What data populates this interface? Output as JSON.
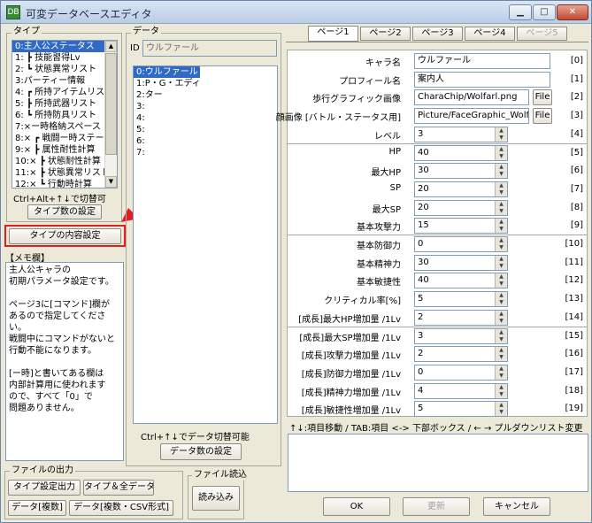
{
  "window": {
    "title": "可変データベースエディタ",
    "icon_label": "DB"
  },
  "type_panel": {
    "label": "タイプ",
    "items": [
      "0:主人公ステータス",
      "1: ┣ 技能習得Lv",
      "2: ┗ 状態異常リスト",
      "3:パーティー情報",
      "4: ┏ 所持アイテムリスト",
      "5: ┣ 所持武器リスト",
      "6: ┗ 所持防具リスト",
      "7:×ー時格納スペース",
      "8:× ┏ 戦闘ー時ステータス",
      "9:× ┣ 属性耐性計算",
      "10:× ┣ 状態耐性計算",
      "11:× ┣ 状態異常リスト",
      "12:× ┗ 行動時計算"
    ],
    "selected_index": 0,
    "hint": "Ctrl+Alt+↑↓で切替可",
    "set_count_button": "タイプ数の設定",
    "content_setting_button": "タイプの内容設定"
  },
  "memo": {
    "label": "【メモ欄】",
    "text": "主人公キャラの\n初期パラメータ設定です。\n\nページ3に[コマンド]欄が\nあるので指定してください。\n戦闘中にコマンドがないと\n行動不能になります。\n\n[ー時]と書いてある欄は\n内部計算用に使われます\nので、すべて「0」で\n問題ありません。"
  },
  "data_panel": {
    "label": "データ",
    "id_label": "ID",
    "id_value": "ウルファール",
    "items": [
      "0:ウルファール",
      "1:P・G・エディ",
      "2:ター",
      "3:",
      "4:",
      "5:",
      "6:",
      "7:"
    ],
    "selected_index": 0,
    "hint": "Ctrl+↑↓でデータ切替可能",
    "set_count_button": "データ数の設定"
  },
  "file_output": {
    "label": "ファイルの出力",
    "buttons": [
      "タイプ設定出力",
      "タイプ＆全データ",
      "データ[複数]",
      "データ[複数・CSV形式]"
    ]
  },
  "file_read": {
    "label": "ファイル読込",
    "button": "読み込み"
  },
  "tabs": [
    {
      "label": "ページ1",
      "state": "active"
    },
    {
      "label": "ページ2",
      "state": "normal"
    },
    {
      "label": "ページ3",
      "state": "normal"
    },
    {
      "label": "ページ4",
      "state": "normal"
    },
    {
      "label": "ページ5",
      "state": "disabled"
    }
  ],
  "properties": [
    {
      "label": "キャラ名",
      "value": "ウルファール",
      "index": "[0]",
      "kind": "text"
    },
    {
      "label": "プロフィール名",
      "value": "案内人",
      "index": "[1]",
      "kind": "text"
    },
    {
      "label": "歩行グラフィック画像",
      "value": "CharaChip/Wolfarl.png",
      "index": "[2]",
      "kind": "file",
      "file_button": "File"
    },
    {
      "label": "顔画像 [バトル・ステータス用]",
      "value": "Picture/FaceGraphic_Wolfa",
      "index": "[3]",
      "kind": "file",
      "file_button": "File"
    },
    {
      "label": "レベル",
      "value": "3",
      "index": "[4]",
      "kind": "num"
    },
    {
      "label": "HP",
      "value": "40",
      "index": "[5]",
      "kind": "num"
    },
    {
      "label": "最大HP",
      "value": "30",
      "index": "[6]",
      "kind": "num"
    },
    {
      "label": "SP",
      "value": "20",
      "index": "[7]",
      "kind": "num"
    },
    {
      "label": "最大SP",
      "value": "20",
      "index": "[8]",
      "kind": "num"
    },
    {
      "label": "基本攻撃力",
      "value": "15",
      "index": "[9]",
      "kind": "num"
    },
    {
      "label": "基本防御力",
      "value": "0",
      "index": "[10]",
      "kind": "num"
    },
    {
      "label": "基本精神力",
      "value": "30",
      "index": "[11]",
      "kind": "num"
    },
    {
      "label": "基本敏捷性",
      "value": "40",
      "index": "[12]",
      "kind": "num"
    },
    {
      "label": "クリティカル率[%]",
      "value": "5",
      "index": "[13]",
      "kind": "num"
    },
    {
      "label": "[成長]最大HP増加量 /1Lv",
      "value": "2",
      "index": "[14]",
      "kind": "num"
    },
    {
      "label": "[成長]最大SP増加量 /1Lv",
      "value": "3",
      "index": "[15]",
      "kind": "num"
    },
    {
      "label": "[成長]攻撃力増加量 /1Lv",
      "value": "2",
      "index": "[16]",
      "kind": "num"
    },
    {
      "label": "[成長]防御力増加量 /1Lv",
      "value": "0",
      "index": "[17]",
      "kind": "num"
    },
    {
      "label": "[成長]精神力増加量 /1Lv",
      "value": "4",
      "index": "[18]",
      "kind": "num"
    },
    {
      "label": "[成長]敏捷性増加量 /1Lv",
      "value": "5",
      "index": "[19]",
      "kind": "num"
    }
  ],
  "help_text": "↑↓:項目移動 / TAB:項目 <-> 下部ボックス / ← → プルダウンリスト変更",
  "bottom_buttons": {
    "ok": "OK",
    "update": "更新",
    "cancel": "キャンセル"
  },
  "colors": {
    "selection": "#316ac5",
    "highlight": "#e02020",
    "window_bg": "#ece9d8"
  }
}
